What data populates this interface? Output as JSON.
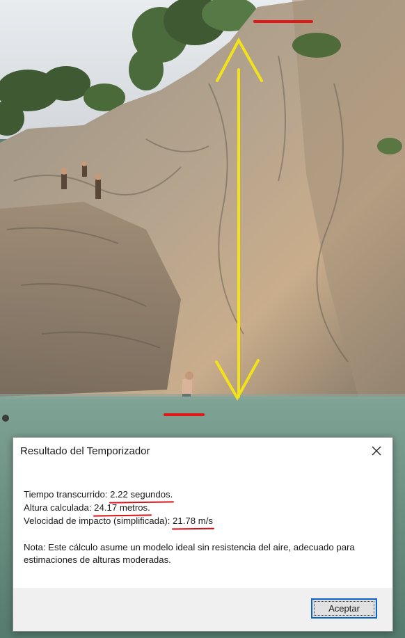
{
  "dialog": {
    "title": "Resultado del Temporizador",
    "elapsed_label": "Tiempo transcurrido: ",
    "elapsed_value": "2.22 segundos.",
    "height_label": "Altura calculada: ",
    "height_value": "24.17 metros.",
    "velocity_label": "Velocidad de impacto (simplificada): ",
    "velocity_value": "21.78 m/s",
    "note": "Nota: Este cálculo asume un modelo ideal sin resistencia del aire, adecuado para estimaciones de alturas moderadas.",
    "ok_label": "Aceptar"
  },
  "colors": {
    "annotation_arrow": "#f2e21a",
    "annotation_marker": "#e01818",
    "focus_border": "#0a63c9"
  },
  "icons": {
    "close": "close-icon"
  }
}
